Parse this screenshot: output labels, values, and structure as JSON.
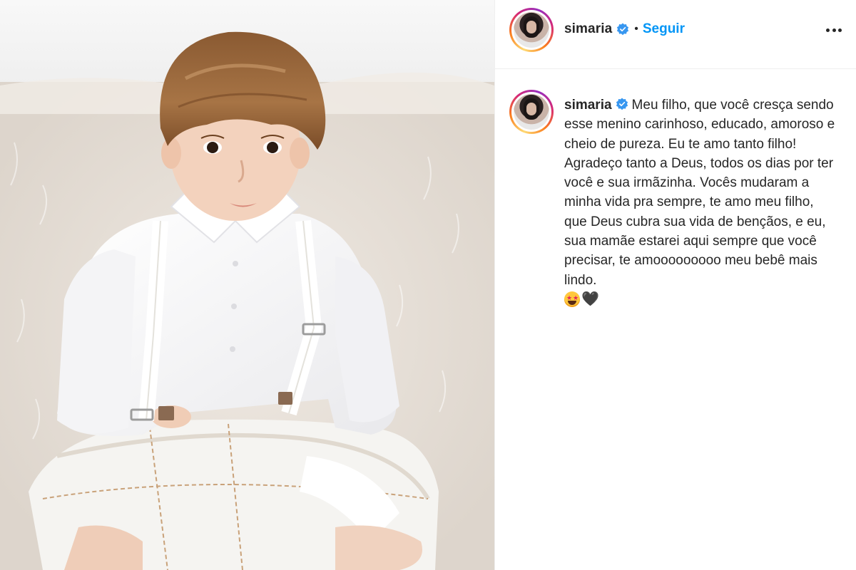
{
  "post": {
    "username": "simaria",
    "follow_label": "Seguir",
    "separator": "•",
    "caption_text": "Meu filho, que você cresça sendo esse menino carinhoso, educado, amoroso e cheio de pureza. Eu te amo tanto filho! Agradeço tanto a Deus, todos os dias por ter você e sua irmãzinha. Vocês mudaram a minha vida pra sempre, te amo meu filho, que Deus cubra sua vida de bençãos, e eu, sua mamãe estarei aqui sempre que você precisar, te amooooooooo meu bebê mais lindo.",
    "emojis": [
      "star-struck",
      "black-heart"
    ],
    "black_heart": "🖤"
  },
  "icons": {
    "verified": "verified-badge-icon",
    "more": "more-options-icon"
  },
  "colors": {
    "accent": "#0095f6",
    "text": "#262626",
    "divider": "#efefef"
  }
}
